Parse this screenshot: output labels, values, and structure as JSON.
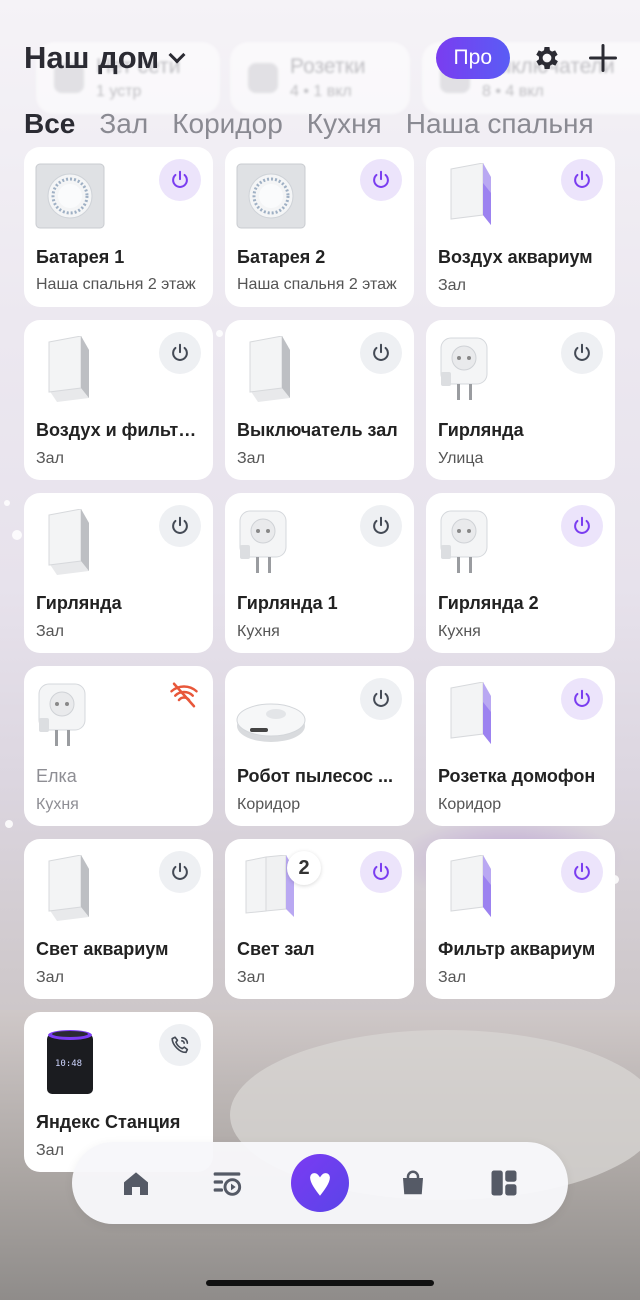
{
  "header": {
    "home_title": "Наш дом",
    "pro_label": "Про"
  },
  "background_groups": [
    {
      "title": "Нет сети",
      "subtitle": "1 устр"
    },
    {
      "title": "Розетки",
      "subtitle": "4 • 1 вкл"
    },
    {
      "title": "Выключатели",
      "subtitle": "8 • 4 вкл"
    }
  ],
  "tabs": [
    "Все",
    "Зал",
    "Коридор",
    "Кухня",
    "Наша спальня"
  ],
  "devices": [
    {
      "name": "Батарея 1",
      "room": "Наша спальня 2 этаж",
      "type": "thermostat",
      "state": "on"
    },
    {
      "name": "Батарея 2",
      "room": "Наша спальня 2 этаж",
      "type": "thermostat",
      "state": "on"
    },
    {
      "name": "Воздух аквариум",
      "room": "Зал",
      "type": "switch-lit",
      "state": "on"
    },
    {
      "name": "Воздух и фильтр...",
      "room": "Зал",
      "type": "switch",
      "state": "off"
    },
    {
      "name": "Выключатель зал",
      "room": "Зал",
      "type": "switch",
      "state": "off"
    },
    {
      "name": "Гирлянда",
      "room": "Улица",
      "type": "plug",
      "state": "off"
    },
    {
      "name": "Гирлянда",
      "room": "Зал",
      "type": "switch",
      "state": "off"
    },
    {
      "name": "Гирлянда 1",
      "room": "Кухня",
      "type": "plug",
      "state": "off"
    },
    {
      "name": "Гирлянда 2",
      "room": "Кухня",
      "type": "plug",
      "state": "on"
    },
    {
      "name": "Елка",
      "room": "Кухня",
      "type": "plug",
      "state": "offline"
    },
    {
      "name": "Робот пылесос ...",
      "room": "Коридор",
      "type": "vacuum",
      "state": "off"
    },
    {
      "name": "Розетка домофон",
      "room": "Коридор",
      "type": "switch-lit",
      "state": "on"
    },
    {
      "name": "Свет аквариум",
      "room": "Зал",
      "type": "switch",
      "state": "off"
    },
    {
      "name": "Свет зал",
      "room": "Зал",
      "type": "switch-double",
      "state": "on",
      "badge": "2"
    },
    {
      "name": "Фильтр аквариум",
      "room": "Зал",
      "type": "switch-lit",
      "state": "on"
    },
    {
      "name": "Яндекс Станция",
      "room": "Зал",
      "type": "speaker",
      "state": "call"
    }
  ],
  "colors": {
    "accent": "#7a3df0",
    "power_on_bg": "#ece4fb",
    "power_off_bg": "#eef0f3",
    "offline": "#e8573a"
  },
  "bottom_nav": [
    "home-icon",
    "scenarios-icon",
    "alice-icon",
    "shop-icon",
    "widgets-icon"
  ]
}
